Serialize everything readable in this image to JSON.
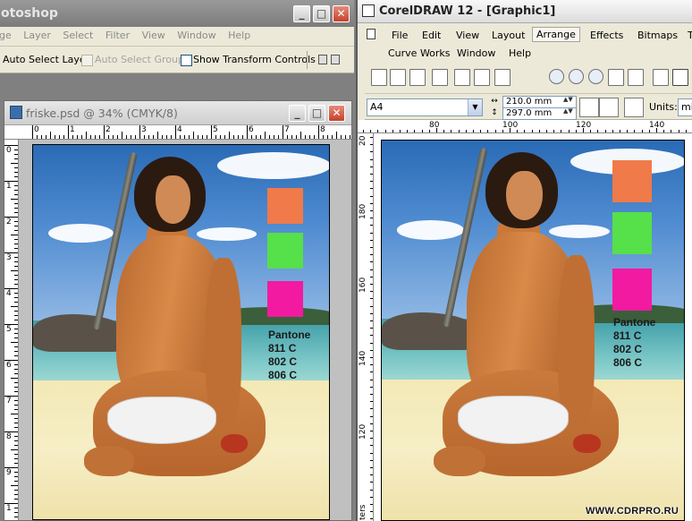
{
  "photoshop": {
    "app_title": "otoshop",
    "menu": [
      "ge",
      "Layer",
      "Select",
      "Filter",
      "View",
      "Window",
      "Help"
    ],
    "options": {
      "auto_select_layer": "Auto Select Layer",
      "auto_select_groups": "Auto Select Groups",
      "show_transform_controls": "Show Transform Controls"
    },
    "document": {
      "title": "friske.psd @ 34% (CMYK/8)",
      "ruler_h": [
        "0",
        "1",
        "2",
        "3",
        "4",
        "5",
        "6",
        "7",
        "8"
      ],
      "ruler_v": [
        "0",
        "1",
        "2",
        "3",
        "4",
        "5",
        "6",
        "7",
        "8",
        "9",
        "1"
      ]
    }
  },
  "coreldraw": {
    "title": "CorelDRAW 12 - [Graphic1]",
    "menu_row1": [
      "File",
      "Edit",
      "View",
      "Layout",
      "Arrange",
      "Effects",
      "Bitmaps",
      "T"
    ],
    "menu_row2": [
      "Curve Works",
      "Window",
      "Help"
    ],
    "property_bar": {
      "page_size": "A4",
      "width": "210.0 mm",
      "height": "297.0 mm",
      "units_label": "Units:",
      "units_value": "mil"
    },
    "ruler_h": [
      "80",
      "100",
      "120",
      "140"
    ],
    "ruler_v": [
      "20",
      "180",
      "160",
      "140",
      "120",
      "ters"
    ]
  },
  "artwork": {
    "swatch_colors": [
      "#f07a4a",
      "#56e04a",
      "#f21aa0"
    ],
    "swatch_label": "Pantone\n811 C\n802 C\n806 C"
  },
  "watermark": "WWW.CDRPRO.RU",
  "icons": [
    "photoshop-doc-icon",
    "coreldraw-icon",
    "minimize-icon",
    "maximize-icon",
    "close-icon",
    "dropdown-arrow-icon",
    "zoom-icon"
  ]
}
